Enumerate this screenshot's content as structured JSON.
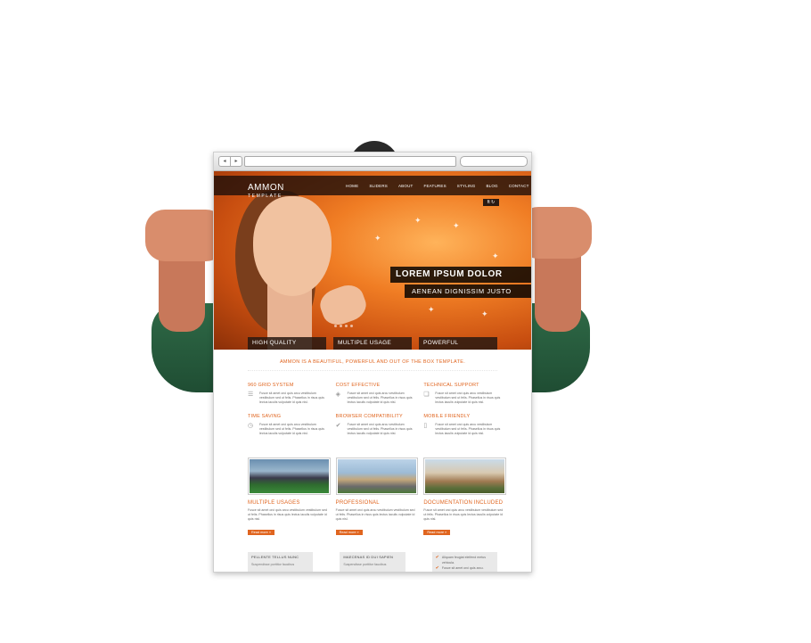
{
  "nav": {
    "back": "◂",
    "forward": "▸"
  },
  "logo": {
    "main": "AMMON",
    "sub": "TEMPLATE"
  },
  "menu": [
    "HOME",
    "SLIDERS",
    "ABOUT",
    "FEATURES",
    "STYLING",
    "BLOG",
    "CONTACT"
  ],
  "social_icon": "ft ↻",
  "hero": {
    "caption_primary": "LOREM IPSUM DOLOR",
    "caption_secondary": "AENEAN DIGNISSIM JUSTO"
  },
  "tabs": [
    "HIGH QUALITY",
    "MULTIPLE USAGE",
    "POWERFUL FRAMEWORK"
  ],
  "tagline": "AMMON IS A BEAUTIFUL, POWERFUL AND OUT OF THE BOX TEMPLATE.",
  "features": [
    {
      "title": "960 GRID SYSTEM",
      "icon": "grid-icon",
      "text": "Fusce sit amet orci quis arcu vestibulum vestibulum sed ut felis. Phasellus in risus quis lectus iaculis vulputate id quis nisl."
    },
    {
      "title": "COST EFFECTIVE",
      "icon": "tag-icon",
      "text": "Fusce sit amet orci quis arcu vestibulum vestibulum sed ut felis. Phasellus in risus quis lectus iaculis vulputate id quis nisl."
    },
    {
      "title": "TECHNICAL SUPPORT",
      "icon": "chat-icon",
      "text": "Fusce sit amet orci quis arcu vestibulum vestibulum sed ut felis. Phasellus in risus quis lectus iaculis vulputate id quis nisl."
    },
    {
      "title": "TIME SAVING",
      "icon": "clock-icon",
      "text": "Fusce sit amet orci quis arcu vestibulum vestibulum sed ut felis. Phasellus in risus quis lectus iaculis vulputate id quis nisl."
    },
    {
      "title": "BROWSER COMPATIBILITY",
      "icon": "check-icon",
      "text": "Fusce sit amet orci quis arcu vestibulum vestibulum sed ut felis. Phasellus in risus quis lectus iaculis vulputate id quis nisl."
    },
    {
      "title": "MOBILE FRIENDLY",
      "icon": "phone-icon",
      "text": "Fusce sit amet orci quis arcu vestibulum vestibulum sed ut felis. Phasellus in risus quis lectus iaculis vulputate id quis nisl."
    }
  ],
  "showcase": [
    {
      "title": "MULTIPLE USAGES",
      "text": "Fusce sit amet orci quis arcu vestibulum vestibulum sed ut felis. Phasellus in risus quis lectus iaculis vulputate id quis nisl.",
      "read_more": "Read more »"
    },
    {
      "title": "PROFESSIONAL",
      "text": "Fusce sit amet orci quis arcu vestibulum vestibulum sed ut felis. Phasellus in risus quis lectus iaculis vulputate id quis nisl.",
      "read_more": "Read more »"
    },
    {
      "title": "DOCUMENTATION INCLUDED",
      "text": "Fusce sit amet orci quis arcu vestibulum vestibulum sed ut felis. Phasellus in risus quis lectus iaculis vulputate id quis nisl.",
      "read_more": "Read more »"
    }
  ],
  "bottom": {
    "box1": {
      "title": "PELLENTE TELLUS NUNC",
      "sub": "Suspendisse porttitor faucibus"
    },
    "box2": {
      "title": "MAECENAS ID DUI SAPIEN",
      "sub": "Suspendisse porttitor faucibus"
    },
    "checklist": [
      "Aliquam feugiat eleifend metus vehicula.",
      "Fusce sit amet orci quis arcu."
    ]
  },
  "colors": {
    "accent": "#e0651f",
    "hero_orange": "#f07d24",
    "caption_bg": "#111111"
  }
}
